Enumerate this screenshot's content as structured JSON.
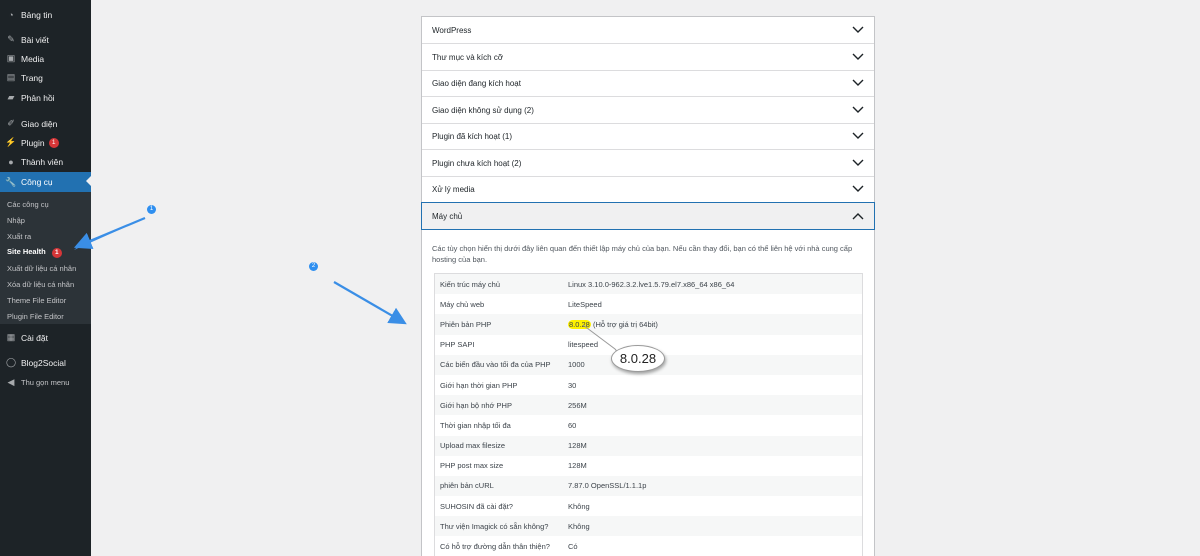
{
  "sidebar": {
    "items": [
      {
        "label": "Bảng tin",
        "icon": "dashboard-icon"
      },
      {
        "label": "Bài viết",
        "icon": "pin-icon"
      },
      {
        "label": "Media",
        "icon": "media-icon"
      },
      {
        "label": "Trang",
        "icon": "page-icon"
      },
      {
        "label": "Phản hồi",
        "icon": "comment-icon"
      },
      {
        "label": "Giao diện",
        "icon": "brush-icon"
      },
      {
        "label": "Plugin",
        "icon": "plugin-icon",
        "badge": "1"
      },
      {
        "label": "Thành viên",
        "icon": "users-icon"
      },
      {
        "label": "Công cụ",
        "icon": "wrench-icon"
      },
      {
        "label": "Cài đặt",
        "icon": "settings-icon"
      },
      {
        "label": "Blog2Social",
        "icon": "blog2social-icon"
      },
      {
        "label": "Thu gọn menu",
        "icon": "collapse-icon"
      }
    ],
    "submenu": [
      {
        "label": "Các công cụ"
      },
      {
        "label": "Nhập"
      },
      {
        "label": "Xuất ra"
      },
      {
        "label": "Site Health",
        "badge": "1"
      },
      {
        "label": "Xuất dữ liệu cá nhân"
      },
      {
        "label": "Xóa dữ liệu cá nhân"
      },
      {
        "label": "Theme File Editor"
      },
      {
        "label": "Plugin File Editor"
      }
    ]
  },
  "accordion": [
    "WordPress",
    "Thư mục và kích cỡ",
    "Giao diện đang kích hoạt",
    "Giao diện không sử dụng (2)",
    "Plugin đã kích hoạt (1)",
    "Plugin chưa kích hoạt (2)",
    "Xử lý media",
    "Máy chủ"
  ],
  "server": {
    "description": "Các tùy chọn hiển thị dưới đây liên quan đến thiết lập máy chủ của bạn. Nếu cần thay đổi, bạn có thể liên hệ với nhà cung cấp hosting của bạn.",
    "rows": [
      {
        "key": "Kiến trúc máy chủ",
        "value": "Linux 3.10.0-962.3.2.lve1.5.79.el7.x86_64 x86_64"
      },
      {
        "key": "Máy chủ web",
        "value": "LiteSpeed"
      },
      {
        "key": "Phiên bản PHP",
        "value": "8.0.28",
        "value_suffix": " (Hỗ trợ giá trị 64bit)"
      },
      {
        "key": "PHP SAPI",
        "value": "litespeed"
      },
      {
        "key": "Các biến đầu vào tối đa của PHP",
        "value": "1000"
      },
      {
        "key": "Giới hạn thời gian PHP",
        "value": "30"
      },
      {
        "key": "Giới hạn bộ nhớ PHP",
        "value": "256M"
      },
      {
        "key": "Thời gian nhập tối đa",
        "value": "60"
      },
      {
        "key": "Upload max filesize",
        "value": "128M"
      },
      {
        "key": "PHP post max size",
        "value": "128M"
      },
      {
        "key": "phiên bản cURL",
        "value": "7.87.0 OpenSSL/1.1.1p"
      },
      {
        "key": "SUHOSIN đã cài đặt?",
        "value": "Không"
      },
      {
        "key": "Thư viện Imagick có sẵn không?",
        "value": "Không"
      },
      {
        "key": "Có hỗ trợ đường dẫn thân thiện?",
        "value": "Có"
      }
    ]
  },
  "annotations": {
    "callout": "8.0.28",
    "step1": "1",
    "step2": "2",
    "arrow_color": "#3a8ee6",
    "highlight_color": "#fff200"
  },
  "colors": {
    "sidebar_bg": "#1d2327",
    "accent": "#2271b1",
    "badge": "#d63638"
  }
}
